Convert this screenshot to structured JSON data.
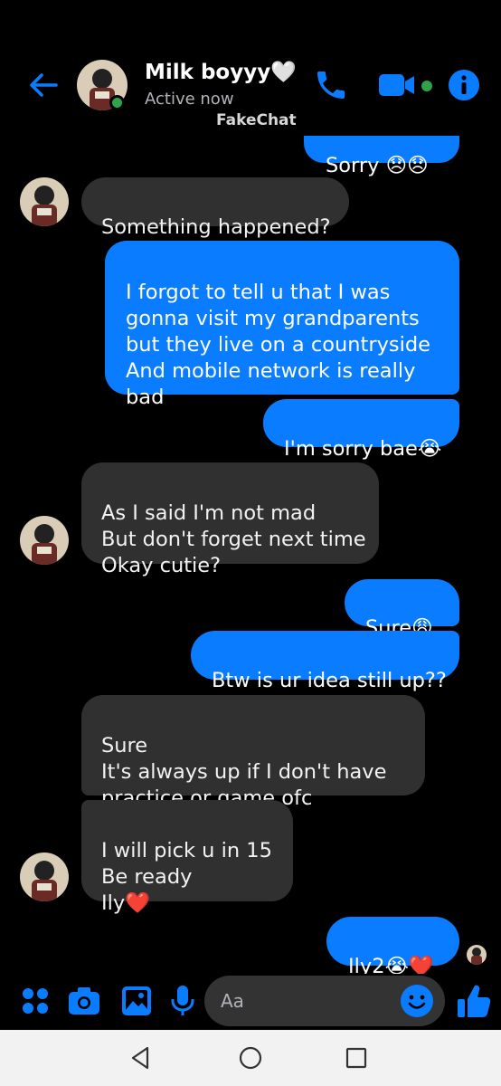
{
  "header": {
    "contact_name": "Milk boyyy🤍",
    "status": "Active now",
    "watermark": "FakeChat"
  },
  "colors": {
    "accent": "#0a7cff",
    "sent_bubble": "#0a7cff",
    "received_bubble": "#303030",
    "active_green": "#31a24c",
    "background": "#000000"
  },
  "messages": [
    {
      "text": "Sorry 😞😞"
    },
    {
      "text": "Something happened?"
    },
    {
      "text": "I forgot to tell u that I was\ngonna visit my grandparents\nbut they live on a countryside\nAnd mobile network is really\nbad"
    },
    {
      "text": "I'm sorry bae😭"
    },
    {
      "text": "As I said I'm not mad\nBut don't forget next time\nOkay cutie?"
    },
    {
      "text": "Sure😩"
    },
    {
      "text": "Btw is ur idea still up??"
    },
    {
      "text": "Sure\nIt's always up if I don't have\npractice or game ofc"
    },
    {
      "text": "I will pick u in 15\nBe ready\nIly❤️"
    },
    {
      "text": "Ily2😭❤️"
    }
  ],
  "composer": {
    "placeholder": "Aa",
    "icons": [
      "apps-icon",
      "camera-icon",
      "gallery-icon",
      "microphone-icon",
      "emoji-icon",
      "thumbs-up-icon"
    ]
  },
  "navbar": {
    "icons": [
      "back-triangle-icon",
      "home-circle-icon",
      "recents-square-icon"
    ]
  }
}
